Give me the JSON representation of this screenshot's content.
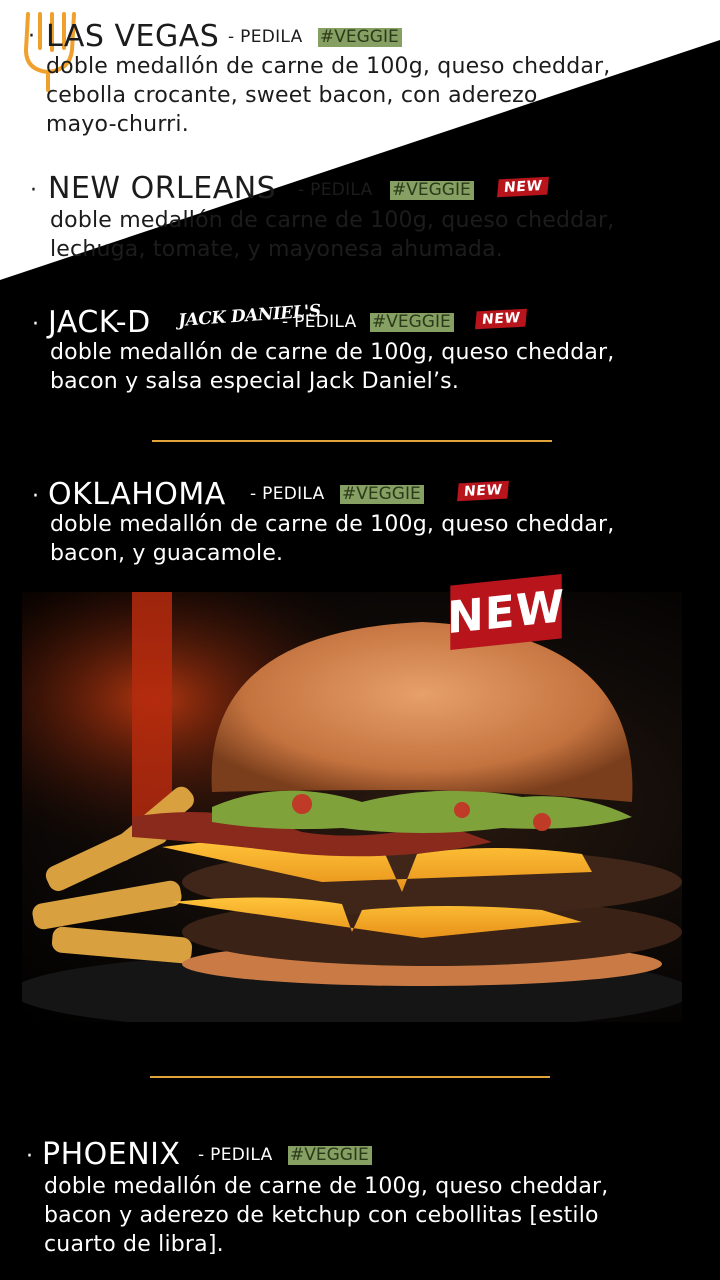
{
  "colors": {
    "veggie_bg": "#86a064",
    "new_badge": "#b8141b",
    "divider": "#e0a43a"
  },
  "bullet": "·",
  "items": [
    {
      "name": "LAS VEGAS",
      "pedila": "- PEDILA",
      "veggie": "#VEGGIE",
      "desc": [
        "doble medallón de carne de 100g, queso cheddar,",
        "cebolla crocante, sweet bacon, con aderezo",
        "mayo-churri."
      ]
    },
    {
      "name": "NEW ORLEANS",
      "pedila": "- PEDILA",
      "veggie": "#VEGGIE",
      "badge": "NEW",
      "desc": [
        "doble medallón de carne de 100g, queso cheddar,",
        "lechuga, tomate, y mayonesa ahumada."
      ]
    },
    {
      "name": "JACK-D",
      "brand_logo_text": "JACK DANIEL'S",
      "pedila": "- PEDILA",
      "veggie": "#VEGGIE",
      "badge": "NEW",
      "desc": [
        "doble medallón de carne de 100g, queso cheddar,",
        "bacon y salsa especial Jack Daniel’s."
      ]
    },
    {
      "name": "OKLAHOMA",
      "pedila": "- PEDILA",
      "veggie": "#VEGGIE",
      "badge": "NEW",
      "desc": [
        "doble medallón de carne de 100g, queso cheddar,",
        "bacon, y guacamole."
      ]
    },
    {
      "name": "PHOENIX",
      "pedila": "- PEDILA",
      "veggie": "#VEGGIE",
      "desc": [
        "doble medallón de carne de 100g, queso cheddar,",
        "bacon y aderezo de ketchup con cebollitas [estilo",
        "cuarto de libra]."
      ]
    }
  ],
  "photo": {
    "badge": "NEW"
  }
}
